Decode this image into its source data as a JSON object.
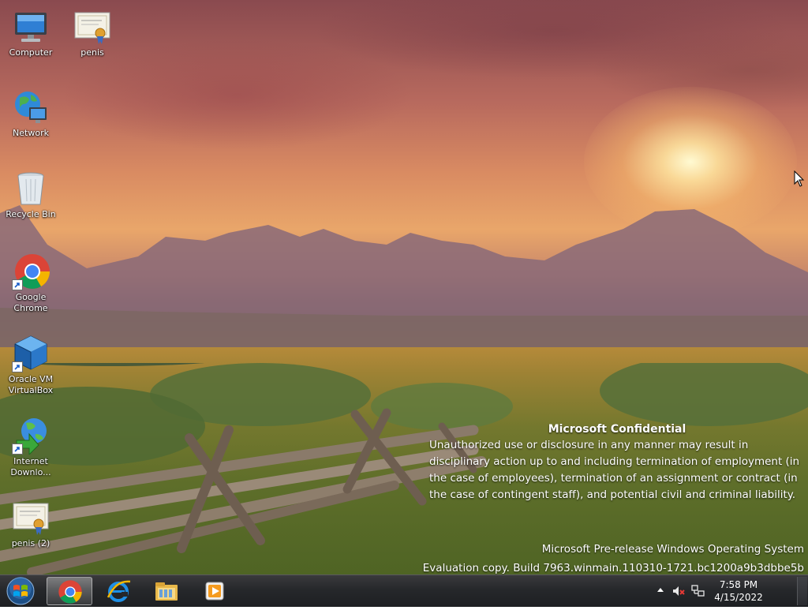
{
  "desktop": {
    "icons": [
      {
        "label": "Computer",
        "icon": "computer-icon"
      },
      {
        "label": "penis",
        "icon": "certificate-icon"
      },
      {
        "label": "Network",
        "icon": "network-icon"
      },
      {
        "label": "Recycle Bin",
        "icon": "recycle-bin-icon"
      },
      {
        "label": "Google\nChrome",
        "icon": "chrome-icon",
        "shortcut": true
      },
      {
        "label": "Oracle VM\nVirtualBox",
        "icon": "virtualbox-icon",
        "shortcut": true
      },
      {
        "label": "Internet\nDownlo...",
        "icon": "internet-download-manager-icon",
        "shortcut": true
      },
      {
        "label": "penis (2)",
        "icon": "certificate-icon"
      }
    ]
  },
  "watermark": {
    "title": "Microsoft Confidential",
    "body": "Unauthorized use or disclosure in any manner may result in disciplinary action up to and including termination of employment (in the case of employees), termination of an assignment or contract (in the case of contingent staff), and potential civil and criminal liability.",
    "os_line": "Microsoft Pre-release Windows Operating System",
    "build_line": "Evaluation copy. Build 7963.winmain.110310-1721.bc1200a9b3dbbe5b"
  },
  "taskbar": {
    "start_icon": "windows-start-orb-icon",
    "pinned": [
      {
        "name": "chrome",
        "icon": "chrome-icon",
        "active": true
      },
      {
        "name": "internet-explorer",
        "icon": "internet-explorer-icon",
        "active": false
      },
      {
        "name": "windows-explorer",
        "icon": "folder-icon",
        "active": false
      },
      {
        "name": "media-player",
        "icon": "media-player-icon",
        "active": false
      }
    ],
    "tray": {
      "show_hidden_icon": "chevron-up-icon",
      "volume_icon": "speaker-muted-icon",
      "network_icon": "network-tray-icon",
      "time": "7:58 PM",
      "date": "4/15/2022"
    }
  }
}
